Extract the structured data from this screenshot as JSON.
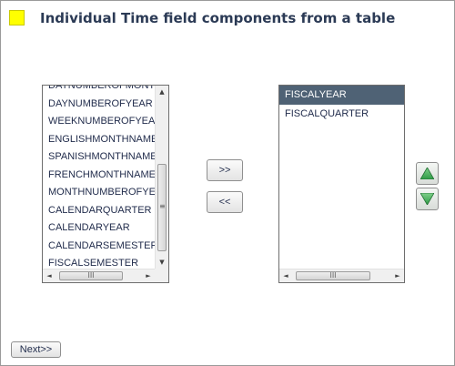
{
  "header": {
    "title": "Individual Time field components from a table",
    "icon": "yellow-square-icon",
    "icon_color": "#ffff00"
  },
  "available_list": {
    "items": [
      "DAYNUMBEROFMONTH",
      "DAYNUMBEROFYEAR",
      "WEEKNUMBEROFYEAR",
      "ENGLISHMONTHNAME",
      "SPANISHMONTHNAME",
      "FRENCHMONTHNAME",
      "MONTHNUMBEROFYEAR",
      "CALENDARQUARTER",
      "CALENDARYEAR",
      "CALENDARSEMESTER",
      "FISCALSEMESTER"
    ],
    "scroll_glyphs": {
      "up": "▲",
      "down": "▼",
      "left": "◄",
      "right": "►",
      "grip_v": "≡",
      "grip_h": "III"
    }
  },
  "selected_list": {
    "items": [
      "FISCALYEAR",
      "FISCALQUARTER"
    ],
    "selected_index": 0,
    "selected_color": "#4f6275"
  },
  "buttons": {
    "add": ">>",
    "remove": "<<",
    "next": "Next>>",
    "move_up": "arrow-up-icon",
    "move_down": "arrow-down-icon",
    "arrow_color": "#2e9a45"
  }
}
